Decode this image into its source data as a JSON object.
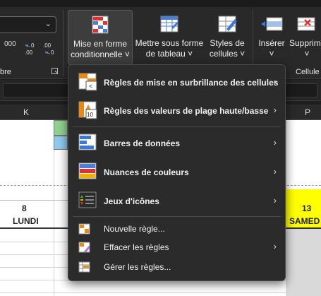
{
  "ribbon": {
    "number_group_label": "bre",
    "number_buttons": [
      "000",
      "←0 .00",
      ".00 →0"
    ],
    "cell_group_label": "Cellule",
    "buttons": {
      "conditional_format": [
        "Mise en forme",
        "conditionnelle ˅"
      ],
      "format_as_table": [
        "Mettre sous forme",
        "de tableau ˅"
      ],
      "cell_styles": [
        "Styles de",
        "cellules ˅"
      ],
      "insert": [
        "Insérer",
        "˅"
      ],
      "delete": [
        "Supprim",
        "˅"
      ]
    }
  },
  "sheet": {
    "column_headers": [
      "K",
      "P"
    ],
    "days": [
      {
        "num": "8",
        "name": "LUNDI"
      },
      {
        "num": "13",
        "name": "SAMED"
      }
    ],
    "highlight_color": "#ffff00"
  },
  "menu": {
    "items": [
      {
        "label": "Règles de mise en surbrillance des cellules",
        "has_submenu": true
      },
      {
        "label": "Règles des valeurs de plage haute/basse",
        "has_submenu": true
      },
      {
        "label": "Barres de données",
        "has_submenu": true
      },
      {
        "label": "Nuances de couleurs",
        "has_submenu": true
      },
      {
        "label": "Jeux d'icônes",
        "has_submenu": true
      },
      {
        "label": "Nouvelle règle...",
        "has_submenu": false
      },
      {
        "label": "Effacer les règles",
        "has_submenu": true
      },
      {
        "label": "Gérer les règles...",
        "has_submenu": false
      }
    ],
    "submenu_arrow": "›"
  }
}
